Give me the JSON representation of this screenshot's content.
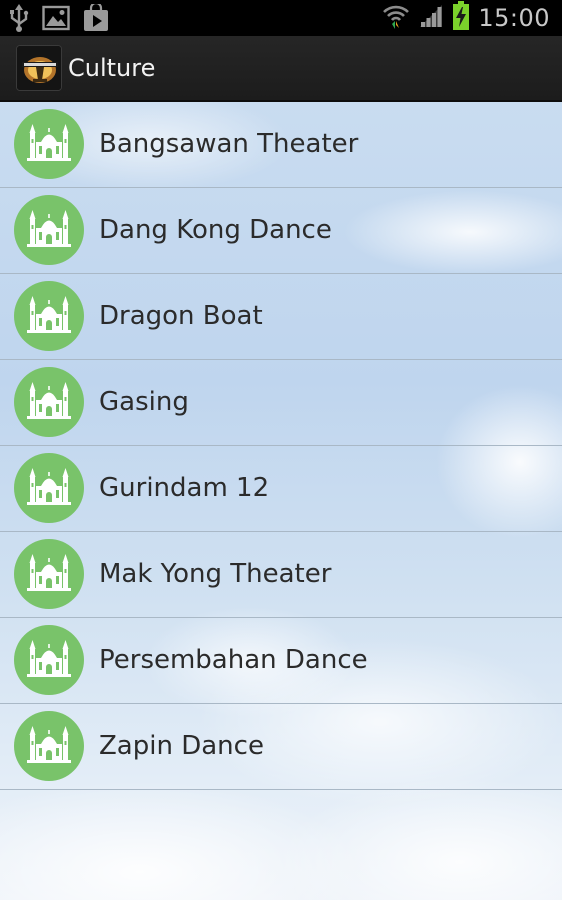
{
  "status_bar": {
    "time": "15:00",
    "left_icons": [
      "usb-icon",
      "image-icon",
      "play-store-icon"
    ],
    "right_icons": [
      "wifi-icon",
      "signal-icon",
      "battery-charging-icon"
    ]
  },
  "action_bar": {
    "title": "Culture",
    "app_icon": "app-logo-icon"
  },
  "list": {
    "items": [
      {
        "label": "Bangsawan Theater",
        "icon": "mosque-icon"
      },
      {
        "label": "Dang Kong Dance",
        "icon": "mosque-icon"
      },
      {
        "label": "Dragon Boat",
        "icon": "mosque-icon"
      },
      {
        "label": "Gasing",
        "icon": "mosque-icon"
      },
      {
        "label": "Gurindam 12",
        "icon": "mosque-icon"
      },
      {
        "label": "Mak Yong Theater",
        "icon": "mosque-icon"
      },
      {
        "label": "Persembahan Dance",
        "icon": "mosque-icon"
      },
      {
        "label": "Zapin Dance",
        "icon": "mosque-icon"
      }
    ]
  },
  "colors": {
    "icon_circle": "#79c36a",
    "action_bar": "#222222",
    "sky": "#c9dcf0"
  }
}
